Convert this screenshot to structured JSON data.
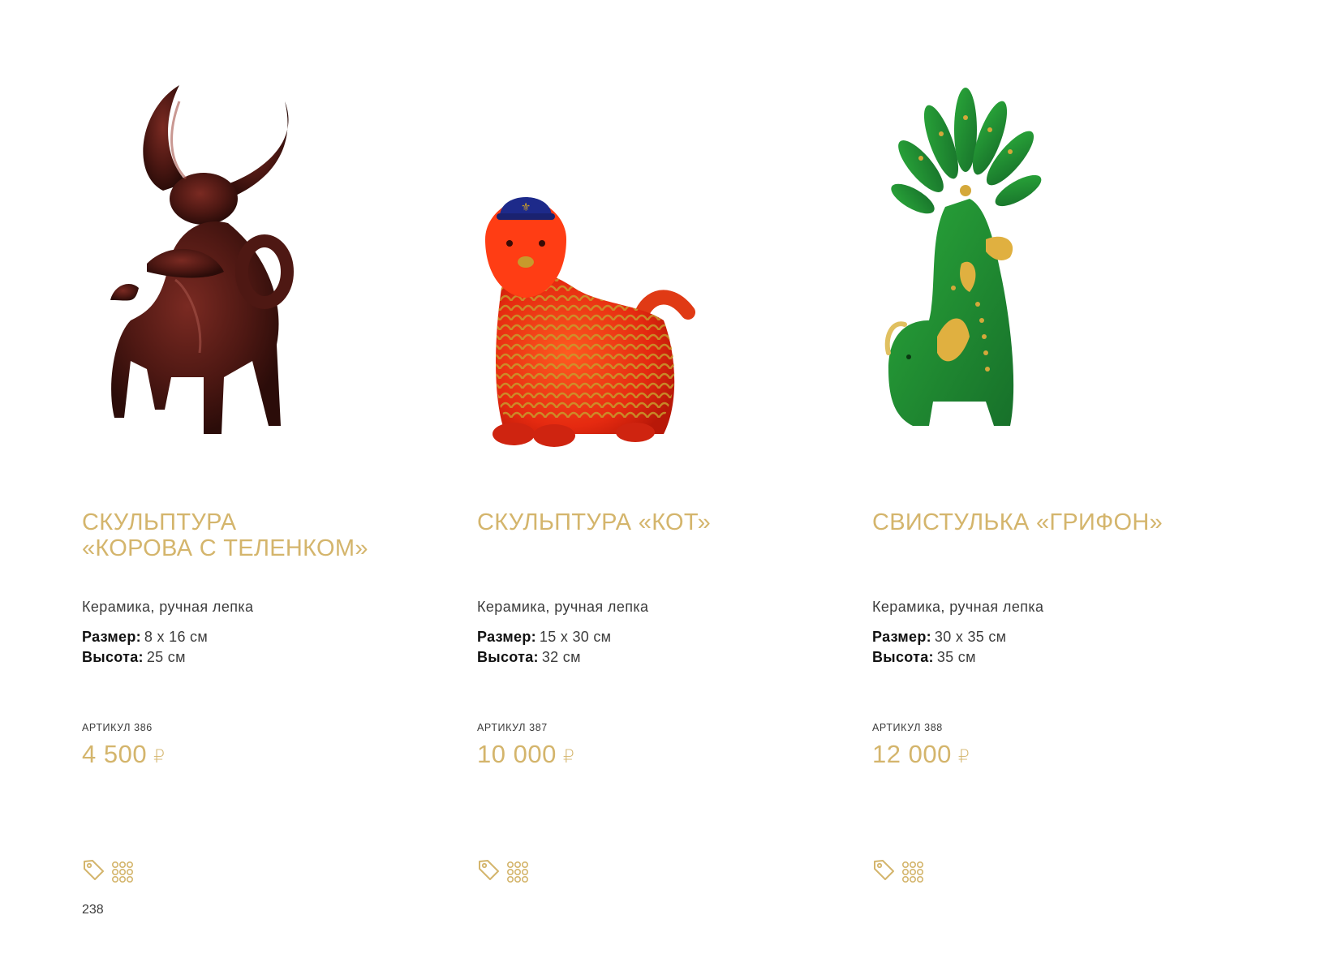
{
  "page": {
    "number": "238"
  },
  "labels": {
    "size": "Размер:",
    "height": "Высота:",
    "currency": "₽"
  },
  "products": [
    {
      "title_line1": "Скульптура",
      "title_line2": "«Корова с теленком»",
      "material": "Керамика, ручная лепка",
      "size": "8 х 16 см",
      "height": "25 см",
      "article": "АРТИКУЛ 386",
      "price": "4 500",
      "image": "ceramic-cow-with-calf-sculpture"
    },
    {
      "title_line1": "Скульптура «Кот»",
      "title_line2": "",
      "material": "Керамика, ручная лепка",
      "size": "15 х 30 см",
      "height": "32 см",
      "article": "АРТИКУЛ 387",
      "price": "10 000",
      "image": "ceramic-cat-sculpture"
    },
    {
      "title_line1": "Свистулька «Грифон»",
      "title_line2": "",
      "material": "Керамика, ручная лепка",
      "size": "30 х 35 см",
      "height": "35 см",
      "article": "АРТИКУЛ 388",
      "price": "12 000",
      "image": "ceramic-griffin-whistle"
    }
  ],
  "icons": {
    "tag": "price-tag-icon",
    "grid": "dots-grid-icon"
  },
  "colors": {
    "accent": "#d4b56c",
    "text": "#3c3c3c",
    "strong": "#111111"
  }
}
